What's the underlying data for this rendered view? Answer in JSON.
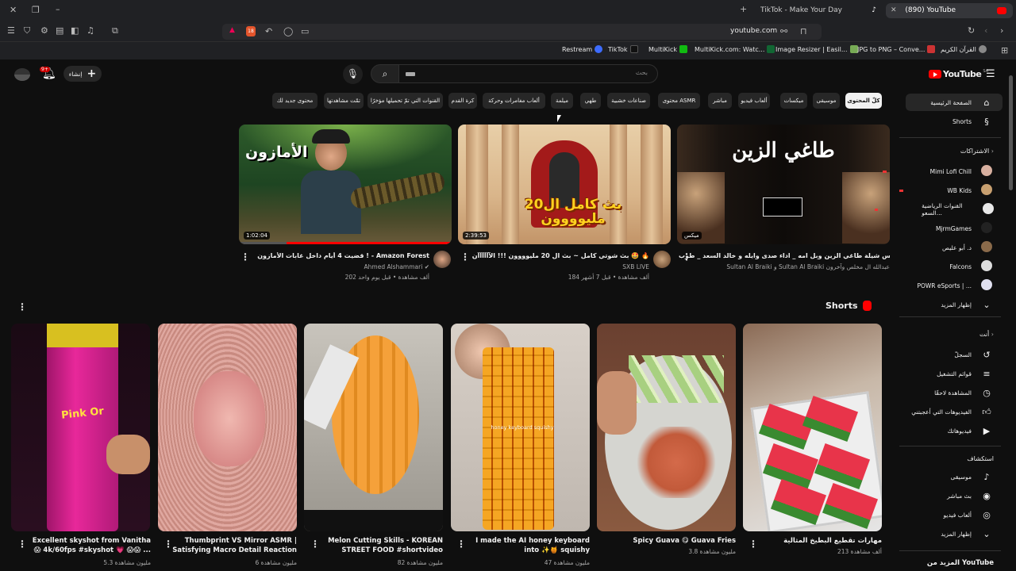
{
  "browser": {
    "tabs": [
      {
        "label": "TikTok - Make Your Day"
      },
      {
        "label": "(890) YouTube"
      }
    ],
    "address": "youtube.com",
    "bookmarks": [
      {
        "label": "Restream"
      },
      {
        "label": "TikTok"
      },
      {
        "label": "MultiKick"
      },
      {
        "label": "MultiKick.com: Watc..."
      },
      {
        "label": "Image Resizer | Easil..."
      },
      {
        "label": "JPG to PNG – Conve..."
      },
      {
        "label": "القرآن الكريم"
      }
    ],
    "shield_count": "18"
  },
  "youtube": {
    "logo": "YouTube",
    "region": "SA",
    "search_placeholder": "بحث",
    "create_label": "إنشاء",
    "notif_count": "9+",
    "chips": [
      "كلّ المحتوى",
      "موسيقى",
      "ميكسات",
      "ألعاب فيديو",
      "مباشر",
      "محتوى ASMR",
      "صناعات خشبية",
      "طهي",
      "ميلمة",
      "ألعاب مغامرات وحركة",
      "كرة القدم",
      "القنوات التي تمّ تحميلها مؤخرًا",
      "تمّت مشاهدتها",
      "محتوى جديد لك"
    ],
    "videos": [
      {
        "title": "مكس شيلة طاغي الزين وبل امه _ اداء صدى وايله و خالد السعد _ طرب",
        "channel": "Sultan Al Braiki و Sultan Al Braiki عبدالله ال مخلص وآخرون",
        "meta": "",
        "duration": "",
        "thumb_text": "طاغي الزين",
        "badge": "ميكس"
      },
      {
        "title": "بث شوتي كامل ~ بث ال 20 مليوووون !!! الآآآآآآن 🤩 🔥",
        "channel": "SXB LIVE",
        "meta": "184 ألف مشاهدة • قبل 7 أشهر",
        "duration": "2:39:53",
        "thumb_text": "بث كامل ال20 مليوووون"
      },
      {
        "title": "قضيت 4 أيام داخل غابات الأمازون ! - Amazon Forest",
        "channel": "Ahmed Alshammari",
        "meta": "202 ألف مشاهدة • قبل يوم واحد",
        "duration": "1:02:04",
        "thumb_text": "الأمازون"
      }
    ],
    "shorts_title": "Shorts",
    "shorts": [
      {
        "title": "مهارات تقطيع البطيخ المثالية",
        "views": "213 ألف مشاهدة"
      },
      {
        "title": "Spicy Guava 😋 Guava Fries",
        "views": "3.8 مليون مشاهدة"
      },
      {
        "title": "I made the AI honey keyboard into ✨🍯 squishy",
        "views": "47 مليون مشاهدة",
        "overlay": "honey keyboard squishy"
      },
      {
        "title": "Melon Cutting Skills - KOREAN STREET FOOD #shortvideo",
        "views": "82 مليون مشاهدة"
      },
      {
        "title": "Thumbprint VS Mirror ASMR | Satisfying Macro Detail Reaction",
        "views": "6 مليون مشاهدة"
      },
      {
        "title": "Excellent skyshot from Vanitha 😱 4k/60fps #skyshot 💗 😱😱 ...",
        "views": "5.3 مليون مشاهدة",
        "overlay": "Pink Or"
      }
    ],
    "sidebar": {
      "main": [
        {
          "label": "الصفحة الرئيسية",
          "icon": "home-icon"
        },
        {
          "label": "Shorts",
          "icon": "shorts-icon"
        }
      ],
      "subs_header": "الاشتراكات",
      "subs": [
        {
          "label": "Mimi Lofi Chill",
          "live": true
        },
        {
          "label": "WB Kids",
          "live": true
        },
        {
          "label": "القنوات الرياضية السعو...",
          "live": true
        },
        {
          "label": "MjrmGames",
          "live": false
        },
        {
          "label": "د. أبو عليص",
          "live": false
        },
        {
          "label": "Falcons",
          "live": false
        },
        {
          "label": "POWR eSports | ...",
          "live": false
        },
        {
          "label": "إظهار المزيد",
          "live": false
        }
      ],
      "you_header": "أنت",
      "you": [
        {
          "label": "السجلّ",
          "icon": "history-icon"
        },
        {
          "label": "قوائم التشغيل",
          "icon": "playlist-icon"
        },
        {
          "label": "المشاهدة لاحقًا",
          "icon": "clock-icon"
        },
        {
          "label": "الفيديوهات التي أعجبتني",
          "icon": "like-icon"
        },
        {
          "label": "فيديوهاتك",
          "icon": "video-icon"
        }
      ],
      "explore_header": "استكشاف",
      "explore": [
        {
          "label": "موسيقى",
          "icon": "music-icon"
        },
        {
          "label": "بث مباشر",
          "icon": "live-icon"
        },
        {
          "label": "ألعاب فيديو",
          "icon": "gaming-icon"
        },
        {
          "label": "إظهار المزيد",
          "icon": "chevron-down-icon"
        }
      ],
      "more_header": "المزيد من YouTube"
    }
  }
}
